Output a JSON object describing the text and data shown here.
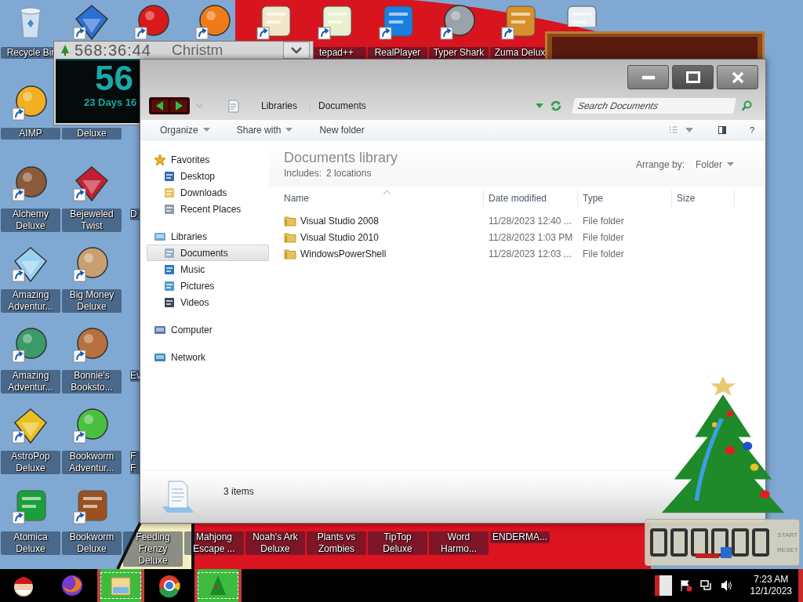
{
  "desktop_icons": [
    {
      "label": "Recycle Bir",
      "shortcut": false
    },
    {
      "shortcut": true
    },
    {
      "shortcut": true
    },
    {
      "shortcut": true
    },
    {
      "shortcut": true
    },
    {
      "label": "tepad++",
      "shortcut": true
    },
    {
      "label": "RealPlayer",
      "shortcut": true
    },
    {
      "label": "Typer Shark",
      "shortcut": true
    },
    {
      "label": "Zuma Delux",
      "shortcut": true
    },
    {
      "shortcut": false
    },
    {
      "label": "AIMP",
      "shortcut": true
    },
    {
      "label": "Alchemy Deluxe",
      "shortcut": true
    },
    {
      "label": "Amazing Adventur...",
      "shortcut": true
    },
    {
      "label": "Amazing Adventur...",
      "shortcut": true
    },
    {
      "label": "AstroPop Deluxe",
      "shortcut": true
    },
    {
      "label": "Atomica Deluxe",
      "shortcut": true
    },
    {
      "label": "Deluxe"
    },
    {
      "label": "Bejeweled Twist",
      "shortcut": true
    },
    {
      "label": "Big Money Deluxe",
      "shortcut": true
    },
    {
      "label": "Bonnie's Booksto...",
      "shortcut": true
    },
    {
      "label": "Bookworm Adventur...",
      "shortcut": true
    },
    {
      "label": "Bookworm Deluxe",
      "shortcut": true
    },
    {
      "label": "D"
    },
    {
      "label": "Ev"
    },
    {
      "label": "F F"
    },
    {
      "label": "Feeding Frenzy Deluxe"
    },
    {
      "label": "Mahjong Escape ..."
    },
    {
      "label": "Noah's Ark Deluxe"
    },
    {
      "label": "Plants vs Zombies"
    },
    {
      "label": "TipTop Deluxe"
    },
    {
      "label": "Word Harmo..."
    },
    {
      "label": "ENDERMA..."
    }
  ],
  "countdown_widget": {
    "time": "568:36:44",
    "title": "Christm",
    "big_number": "56",
    "days": "23 Days 16"
  },
  "explorer": {
    "caption_buttons": [
      {
        "kind": "minimize",
        "hovered": false
      },
      {
        "kind": "maximize",
        "hovered": true
      },
      {
        "kind": "close",
        "hovered": false
      }
    ],
    "breadcrumb": [
      "Libraries",
      "Documents"
    ],
    "search": {
      "placeholder": "Search Documents"
    },
    "toolbar": [
      {
        "label": "Organize",
        "dropdown": true
      },
      {
        "label": "Share with",
        "dropdown": true
      },
      {
        "label": "New folder",
        "dropdown": false
      }
    ],
    "help": "?",
    "nav": [
      {
        "label": "Favorites",
        "selected": false,
        "children": [
          {
            "label": "Desktop",
            "selected": false
          },
          {
            "label": "Downloads",
            "selected": false
          },
          {
            "label": "Recent Places",
            "selected": false
          }
        ]
      },
      {
        "label": "Libraries",
        "selected": false,
        "children": [
          {
            "label": "Documents",
            "selected": true
          },
          {
            "label": "Music",
            "selected": false
          },
          {
            "label": "Pictures",
            "selected": false
          },
          {
            "label": "Videos",
            "selected": false
          }
        ]
      },
      {
        "label": "Computer",
        "selected": false
      },
      {
        "label": "Network",
        "selected": false
      }
    ],
    "library": {
      "title": "Documents library",
      "includes_label": "Includes:",
      "includes_link": "2 locations",
      "arrange_label": "Arrange by:",
      "arrange_value": "Folder"
    },
    "columns": [
      {
        "label": "Name",
        "sorted": true
      },
      {
        "label": "Date modified",
        "sorted": false
      },
      {
        "label": "Type",
        "sorted": false
      },
      {
        "label": "Size",
        "sorted": false
      }
    ],
    "rows": [
      {
        "name": "Visual Studio 2008",
        "date": "11/28/2023 12:40 ...",
        "type": "File folder"
      },
      {
        "name": "Visual Studio 2010",
        "date": "11/28/2023 1:03 PM",
        "type": "File folder"
      },
      {
        "name": "WindowsPowerShell",
        "date": "11/28/2023 12:03 ...",
        "type": "File folder"
      }
    ],
    "status": "3 items"
  },
  "tree_timer": {
    "buttons": [
      "START",
      "RESET"
    ]
  },
  "taskbar": {
    "buttons": [
      {
        "active": false
      },
      {
        "active": false
      },
      {
        "active": true
      },
      {
        "active": false
      },
      {
        "active": true
      }
    ],
    "clock_time": "7:23 AM",
    "clock_date": "12/1/2023"
  }
}
